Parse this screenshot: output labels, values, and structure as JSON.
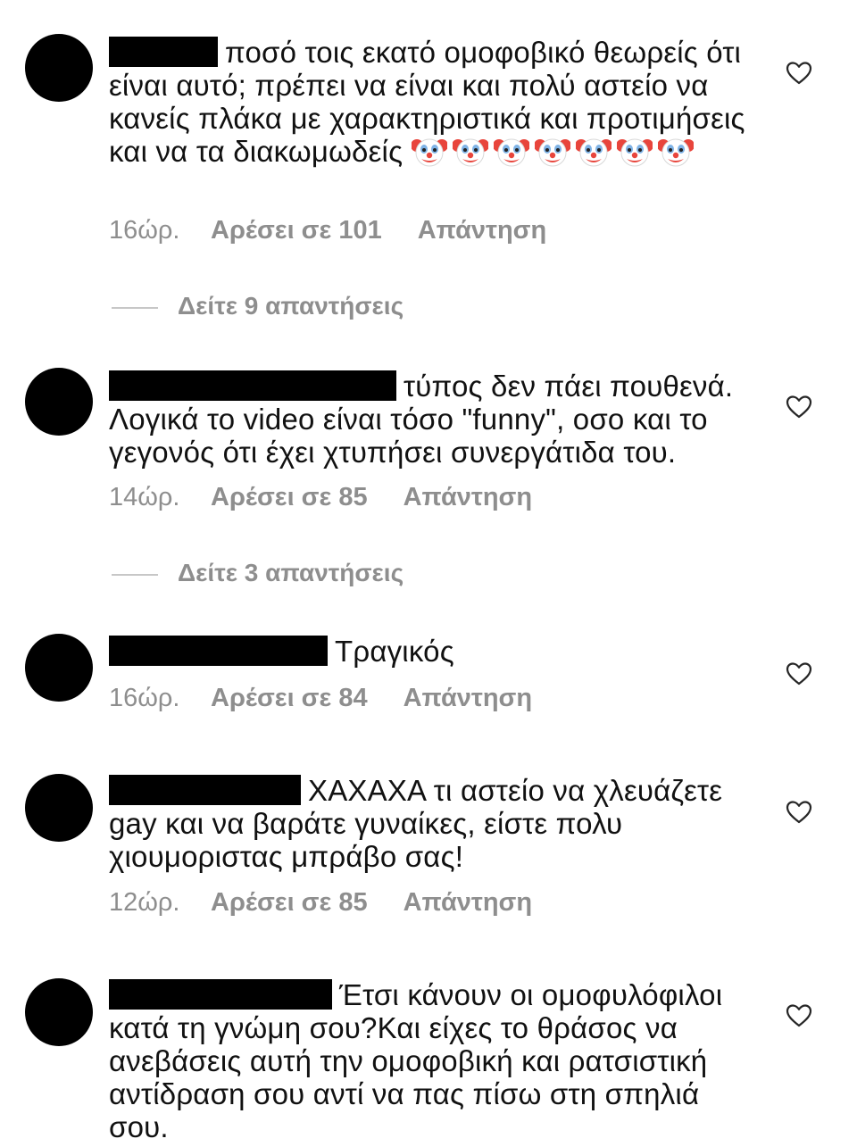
{
  "colors": {
    "text": "#111111",
    "muted": "#8e8e8e",
    "redaction": "#000000",
    "clown_face": "#ffffff",
    "clown_hair": "#e8453c"
  },
  "comments": [
    {
      "text": "ποσό τοις εκατό ομοφοβικό θεωρείς ότι είναι αυτό; πρέπει να είναι και πολύ αστείο να κανείς πλάκα με χαρακτηριστικά και προτιμήσεις και να τα διακωμωδείς",
      "emoji": "clown-face-icon x7",
      "time": "16ώρ.",
      "likes": "Αρέσει σε 101",
      "reply": "Απάντηση",
      "view_replies": "Δείτε 9 απαντήσεις"
    },
    {
      "text": "τύπος δεν πάει πουθενά. Λογικά το video είναι τόσο \"funny\", οσο και το γεγονός ότι έχει χτυπήσει συνεργάτιδα του.",
      "time": "14ώρ.",
      "likes": "Αρέσει σε 85",
      "reply": "Απάντηση",
      "view_replies": "Δείτε 3 απαντήσεις"
    },
    {
      "text": "Τραγικός",
      "time": "16ώρ.",
      "likes": "Αρέσει σε 84",
      "reply": "Απάντηση"
    },
    {
      "text": "ΧΑΧΑΧΑ τι αστείο να χλευάζετε gay και να βαράτε γυναίκες, είστε πολυ χιουμοριστας μπράβο σας!",
      "time": "12ώρ.",
      "likes": "Αρέσει σε 85",
      "reply": "Απάντηση"
    },
    {
      "text": "Έτσι κάνουν οι ομοφυλόφιλοι κατά τη γνώμη σου?Και είχες το θράσος να ανεβάσεις αυτή την ομοφοβική και ρατσιστική αντίδραση σου αντί να πας πίσω στη σπηλιά σου."
    }
  ]
}
